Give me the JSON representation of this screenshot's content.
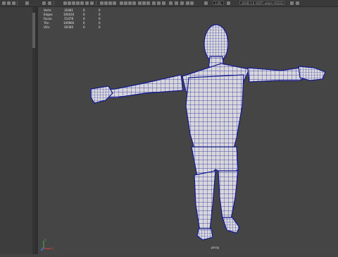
{
  "toolbar": {
    "frame_field": "1.00",
    "renderer_field": "sRGB 1.0 (ODT) adam (ACES)"
  },
  "hud": {
    "rows": [
      {
        "label": "Verts:",
        "value": "20481",
        "c2": "0",
        "c3": "0"
      },
      {
        "label": "Edges:",
        "value": "100416",
        "c2": "0",
        "c3": "0"
      },
      {
        "label": "Faces:",
        "value": "51478",
        "c2": "0",
        "c3": "0"
      },
      {
        "label": "Tris:",
        "value": "100960",
        "c2": "0",
        "c3": "0"
      },
      {
        "label": "UVs:",
        "value": "60360",
        "c2": "0",
        "c3": "0"
      }
    ]
  },
  "viewport": {
    "camera": "persp",
    "background_color": "#454545",
    "wire_color": "#1b1f9a",
    "mesh_color": "#d9d9dd"
  },
  "axis_labels": {
    "x": "X",
    "y": "Y",
    "z": "Z"
  }
}
